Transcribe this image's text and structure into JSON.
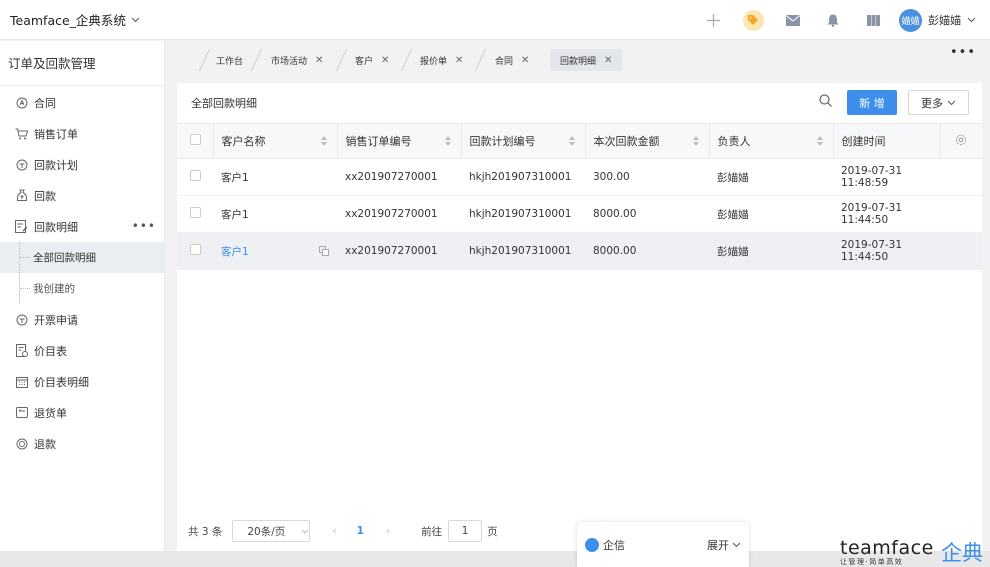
{
  "app": {
    "title": "Teamface_企典系统"
  },
  "user": {
    "avatar_text": "媌媌",
    "name": "彭媌媌"
  },
  "sidebar": {
    "title": "订单及回款管理",
    "items": [
      {
        "label": "合同",
        "icon": "contract-icon"
      },
      {
        "label": "销售订单",
        "icon": "cart-icon"
      },
      {
        "label": "回款计划",
        "icon": "plan-icon"
      },
      {
        "label": "回款",
        "icon": "money-bag-icon"
      },
      {
        "label": "回款明细",
        "icon": "detail-icon"
      }
    ],
    "sub_items": [
      {
        "label": "全部回款明细"
      },
      {
        "label": "我创建的"
      }
    ],
    "items_after": [
      {
        "label": "开票申请",
        "icon": "invoice-icon"
      },
      {
        "label": "价目表",
        "icon": "price-list-icon"
      },
      {
        "label": "价目表明细",
        "icon": "calendar-icon"
      },
      {
        "label": "退货单",
        "icon": "return-icon"
      },
      {
        "label": "退款",
        "icon": "refund-icon"
      }
    ]
  },
  "tabs": [
    {
      "label": "工作台"
    },
    {
      "label": "市场活动"
    },
    {
      "label": "客户"
    },
    {
      "label": "报价单"
    },
    {
      "label": "合同"
    },
    {
      "label": "回款明细"
    }
  ],
  "panel": {
    "title": "全部回款明细",
    "new_label": "新 增",
    "more_label": "更多"
  },
  "table": {
    "columns": [
      "客户名称",
      "销售订单编号",
      "回款计划编号",
      "本次回款金额",
      "负责人",
      "创建时间"
    ],
    "rows": [
      {
        "customer": "客户1",
        "order": "xx201907270001",
        "plan": "hkjh201907310001",
        "amount": "300.00",
        "owner": "彭媌媌",
        "created": "2019-07-31 11:48:59"
      },
      {
        "customer": "客户1",
        "order": "xx201907270001",
        "plan": "hkjh201907310001",
        "amount": "8000.00",
        "owner": "彭媌媌",
        "created": "2019-07-31 11:44:50"
      },
      {
        "customer": "客户1",
        "order": "xx201907270001",
        "plan": "hkjh201907310001",
        "amount": "8000.00",
        "owner": "彭媌媌",
        "created": "2019-07-31 11:44:50"
      }
    ]
  },
  "pager": {
    "total": "共 3 条",
    "page_size": "20条/页",
    "current": "1",
    "goto_label": "前往",
    "goto_value": "1",
    "page_suffix": "页"
  },
  "chat": {
    "label": "企信",
    "expand": "展开"
  },
  "logo": {
    "main": "teamface",
    "cn": "企典",
    "slogan": "让管理·简单高效"
  },
  "colors": {
    "accent": "#3d8eea",
    "tag_bg": "#fbe6b2"
  }
}
